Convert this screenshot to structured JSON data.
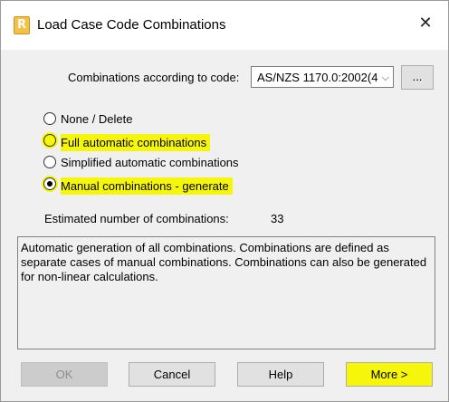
{
  "window": {
    "title": "Load Case Code Combinations",
    "app_icon": "robot-app-icon",
    "close_label": "✕"
  },
  "code": {
    "label": "Combinations according to code:",
    "selected": "AS/NZS 1170.0:2002(4",
    "browse_label": "..."
  },
  "options": [
    {
      "label": "None / Delete",
      "checked": false,
      "highlighted": false
    },
    {
      "label": "Full automatic combinations",
      "checked": false,
      "highlighted": true
    },
    {
      "label": "Simplified automatic combinations",
      "checked": false,
      "highlighted": false
    },
    {
      "label": "Manual combinations - generate",
      "checked": true,
      "highlighted": true
    }
  ],
  "estimate": {
    "label": "Estimated number of combinations:",
    "value": "33"
  },
  "description": "Automatic generation of all combinations. Combinations are defined as separate cases of manual combinations. Combinations can also be generated for non-linear calculations.",
  "buttons": {
    "ok": "OK",
    "cancel": "Cancel",
    "help": "Help",
    "more": "More >"
  },
  "colors": {
    "highlight": "#f6f60a",
    "dialog_bg": "#f0f0f0"
  }
}
